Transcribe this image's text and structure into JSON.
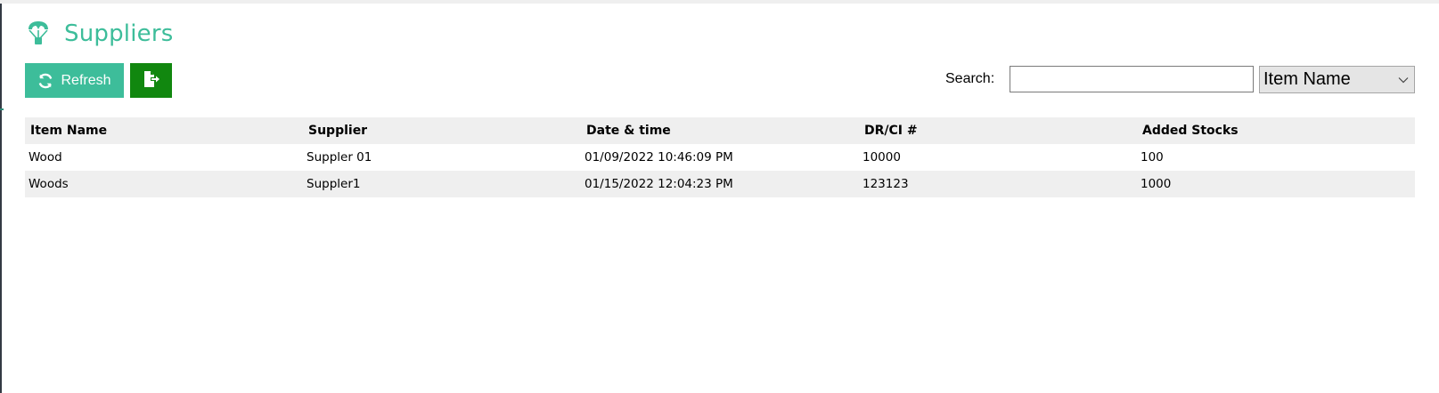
{
  "header": {
    "title": "Suppliers",
    "icon": "parachute-icon",
    "accent_color": "#3dbd9a"
  },
  "toolbar": {
    "refresh_label": "Refresh",
    "refresh_icon": "refresh-icon",
    "refresh_color": "#3dbd9a",
    "export_icon": "export-file-icon",
    "export_color": "#11870f"
  },
  "search": {
    "label": "Search:",
    "value": "",
    "placeholder": "",
    "filter_selected": "Item Name"
  },
  "table": {
    "columns": [
      "Item Name",
      "Supplier",
      "Date & time",
      "DR/CI #",
      "Added Stocks"
    ],
    "rows": [
      [
        "Wood",
        "Suppler 01",
        "01/09/2022 10:46:09 PM",
        "10000",
        "100"
      ],
      [
        "Woods",
        "Suppler1",
        "01/15/2022 12:04:23 PM",
        "123123",
        "1000"
      ]
    ]
  }
}
